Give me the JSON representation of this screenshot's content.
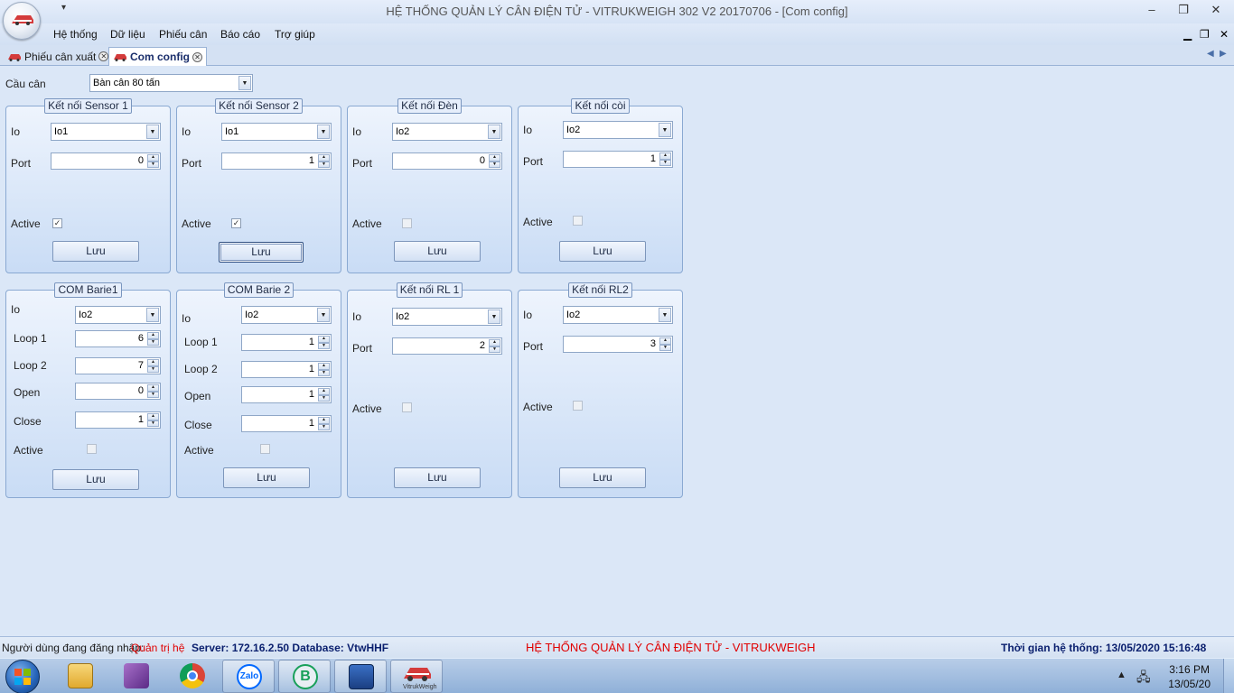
{
  "window": {
    "title": "HỆ THỐNG QUẢN LÝ CÂN ĐIỆN TỬ - VITRUKWEIGH 302 V2 20170706 - [Com config]",
    "minimize": "–",
    "restore": "❐",
    "close": "✕"
  },
  "menu": {
    "items": [
      "Hệ thống",
      "Dữ liệu",
      "Phiếu cân",
      "Báo cáo",
      "Trợ giúp"
    ],
    "mdi_minimize": "▁",
    "mdi_restore": "❐",
    "mdi_close": "✕"
  },
  "tabs": [
    {
      "label": "Phiếu cân xuất"
    },
    {
      "label": "Com config"
    }
  ],
  "scale_select": {
    "label": "Cầu cân",
    "value": "Bàn cân 80 tấn"
  },
  "groups": {
    "sensor1": {
      "title": "Kết nối Sensor 1",
      "io_label": "Io",
      "io": "Io1",
      "port_label": "Port",
      "port": "0",
      "active_label": "Active",
      "active": true,
      "save": "Lưu"
    },
    "sensor2": {
      "title": "Kết nối Sensor 2",
      "io_label": "Io",
      "io": "Io1",
      "port_label": "Port",
      "port": "1",
      "active_label": "Active",
      "active": true,
      "save": "Lưu"
    },
    "den": {
      "title": "Kết nối Đèn",
      "io_label": "Io",
      "io": "Io2",
      "port_label": "Port",
      "port": "0",
      "active_label": "Active",
      "active": false,
      "save": "Lưu"
    },
    "coi": {
      "title": "Kết nối còi",
      "io_label": "Io",
      "io": "Io2",
      "port_label": "Port",
      "port": "1",
      "active_label": "Active",
      "active": false,
      "save": "Lưu"
    },
    "barie1": {
      "title": "COM Barie1",
      "io_label": "Io",
      "io": "Io2",
      "loop1_label": "Loop 1",
      "loop1": "6",
      "loop2_label": "Loop 2",
      "loop2": "7",
      "open_label": "Open",
      "open": "0",
      "close_label": "Close",
      "close": "1",
      "active_label": "Active",
      "active": false,
      "save": "Lưu"
    },
    "barie2": {
      "title": "COM Barie 2",
      "io_label": "Io",
      "io": "Io2",
      "loop1_label": "Loop 1",
      "loop1": "1",
      "loop2_label": "Loop 2",
      "loop2": "1",
      "open_label": "Open",
      "open": "1",
      "close_label": "Close",
      "close": "1",
      "active_label": "Active",
      "active": false,
      "save": "Lưu"
    },
    "rl1": {
      "title": "Kết nối RL 1",
      "io_label": "Io",
      "io": "Io2",
      "port_label": "Port",
      "port": "2",
      "active_label": "Active",
      "active": false,
      "save": "Lưu"
    },
    "rl2": {
      "title": "Kết nối RL2",
      "io_label": "Io",
      "io": "Io2",
      "port_label": "Port",
      "port": "3",
      "active_label": "Active",
      "active": false,
      "save": "Lưu"
    }
  },
  "status": {
    "user_label": "Người dùng đang đăng nhập:",
    "user": "Quản trị hệ",
    "server": "Server: 172.16.2.50 Database: VtwHHF",
    "system_name": "HỆ THỐNG QUẢN LÝ CÂN ĐIỆN TỬ - VITRUKWEIGH",
    "time": "Thời gian hệ thống: 13/05/2020 15:16:48",
    "colors": {
      "user": "#e00000",
      "system_name": "#e00000",
      "info": "#0a1f6e"
    }
  },
  "taskbar": {
    "apps": [
      "windows-explorer",
      "onenote",
      "chrome",
      "zalo",
      "b-app",
      "remote-desktop",
      "vitrukweigh"
    ],
    "zalo_label": "Zalo",
    "b_label": "B",
    "vitruk_label": "VitrukWeigh",
    "time": "3:16 PM",
    "date": "13/05/20"
  }
}
